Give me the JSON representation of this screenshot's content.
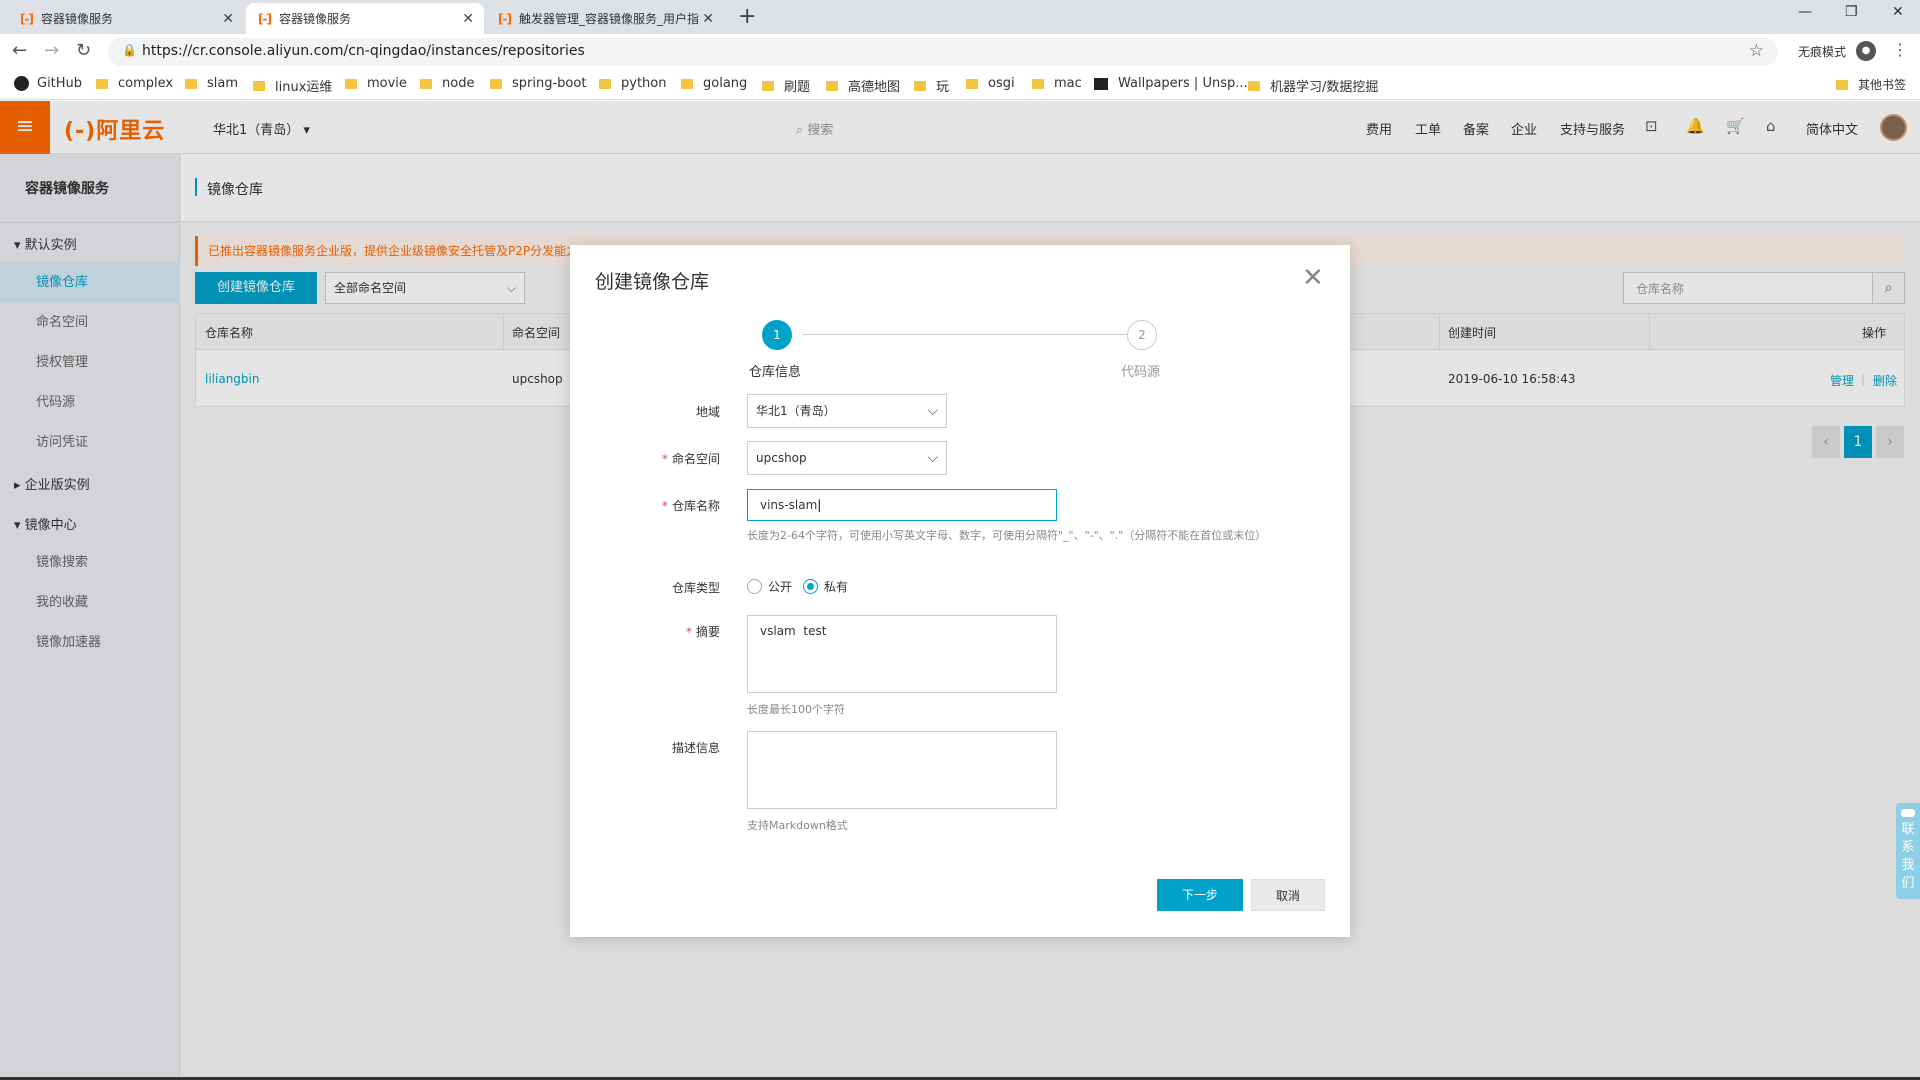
{
  "browser": {
    "tabs": [
      {
        "icon": "[-]",
        "title": "容器镜像服务"
      },
      {
        "icon": "[-]",
        "title": "容器镜像服务"
      },
      {
        "icon": "[-]",
        "title": "触发器管理_容器镜像服务_用户指"
      }
    ],
    "url": "https://cr.console.aliyun.com/cn-qingdao/instances/repositories",
    "incognito_label": "无痕模式",
    "bookmarks": [
      "GitHub",
      "complex",
      "slam",
      "linux运维",
      "movie",
      "node",
      "spring-boot",
      "python",
      "golang",
      "刷题",
      "高德地图",
      "玩",
      "osgi",
      "mac",
      "Wallpapers | Unsp...",
      "机器学习/数据挖掘"
    ],
    "other_bookmarks": "其他书签"
  },
  "console": {
    "logo": "(-)阿里云",
    "region": "华北1（青岛）",
    "search_placeholder": "搜索",
    "nav": [
      "费用",
      "工单",
      "备案",
      "企业",
      "支持与服务"
    ],
    "language": "简体中文"
  },
  "sidebar": {
    "title": "容器镜像服务",
    "group_default": "默认实例",
    "items_default": [
      "镜像仓库",
      "命名空间",
      "授权管理",
      "代码源",
      "访问凭证"
    ],
    "group_enterprise": "企业版实例",
    "group_center": "镜像中心",
    "items_center": [
      "镜像搜索",
      "我的收藏",
      "镜像加速器"
    ]
  },
  "main": {
    "page_title": "镜像仓库",
    "notice": "已推出容器镜像服务企业版，提供企业级镜像安全托管及P2P分发能力",
    "create_button": "创建镜像仓库",
    "namespace_filter": "全部命名空间",
    "search_placeholder": "仓库名称",
    "table": {
      "headers": [
        "仓库名称",
        "命名空间",
        "创建时间",
        "操作"
      ],
      "rows": [
        {
          "name": "liliangbin",
          "namespace": "upcshop",
          "created": "2019-06-10 16:58:43",
          "action_manage": "管理",
          "action_delete": "删除"
        }
      ]
    },
    "pagination": {
      "current": "1"
    }
  },
  "dialog": {
    "title": "创建镜像仓库",
    "steps": [
      {
        "num": "1",
        "label": "仓库信息"
      },
      {
        "num": "2",
        "label": "代码源"
      }
    ],
    "region_label": "地域",
    "region_value": "华北1（青岛）",
    "namespace_label": "命名空间",
    "namespace_value": "upcshop",
    "repo_name_label": "仓库名称",
    "repo_name_value": "vins-slam",
    "repo_name_hint": "长度为2-64个字符，可使用小写英文字母、数字，可使用分隔符\"_\"、\"-\"、\".\"（分隔符不能在首位或末位）",
    "repo_type_label": "仓库类型",
    "repo_type_public": "公开",
    "repo_type_private": "私有",
    "summary_label": "摘要",
    "summary_value": "vslam  test",
    "summary_hint": "长度最长100个字符",
    "desc_label": "描述信息",
    "desc_hint": "支持Markdown格式",
    "next_button": "下一步",
    "cancel_button": "取消"
  },
  "contact": "联系我们"
}
